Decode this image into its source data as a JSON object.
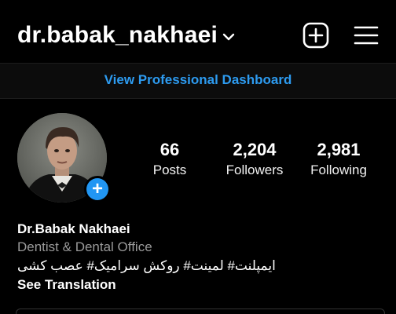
{
  "header": {
    "username": "dr.babak_nakhaei",
    "icons": {
      "dropdown": "chevron-down-icon",
      "new_post": "plus-square-icon",
      "menu": "hamburger-menu-icon"
    }
  },
  "dashboard": {
    "label": "View Professional Dashboard",
    "color": "#2d9bf0"
  },
  "profile": {
    "avatar_icon": "profile-photo",
    "add_story_glyph": "+",
    "stats": [
      {
        "value": "66",
        "label": "Posts"
      },
      {
        "value": "2,204",
        "label": "Followers"
      },
      {
        "value": "2,981",
        "label": "Following"
      }
    ]
  },
  "bio": {
    "name": "Dr.Babak Nakhaei",
    "category": "Dentist & Dental Office",
    "description": "ایمپلنت# لمینت# روکش سرامیک# عصب کشی",
    "translate_label": "See Translation"
  },
  "colors": {
    "background": "#000000",
    "accent": "#2196f3",
    "muted": "#9a9a9a"
  }
}
